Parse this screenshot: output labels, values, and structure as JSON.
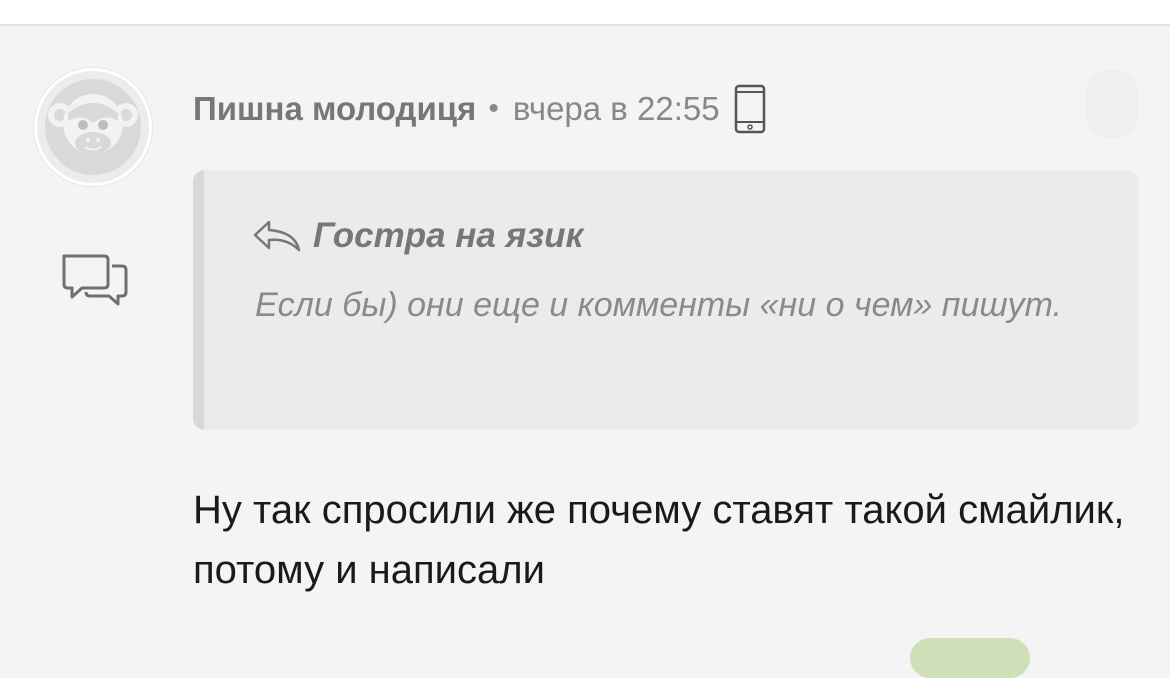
{
  "comment": {
    "author": "Пишна молодиця",
    "separator": "•",
    "time": "вчера в 22:55",
    "device_icon": "smartphone-icon",
    "avatar_icon": "monkey-icon",
    "side_icon": "chat-bubbles-icon",
    "quote": {
      "icon": "reply-arrow-icon",
      "author": "Гостра на язик",
      "text": "Если бы) они еще и комменты «ни о чем» пишут."
    },
    "body": "Ну так спросили же почему ставят такой смайлик, потому и написали"
  },
  "colors": {
    "background": "#f4f4f4",
    "quote_background": "#ebebeb",
    "quote_bar": "#d8d8d8",
    "muted_text": "#777777"
  }
}
